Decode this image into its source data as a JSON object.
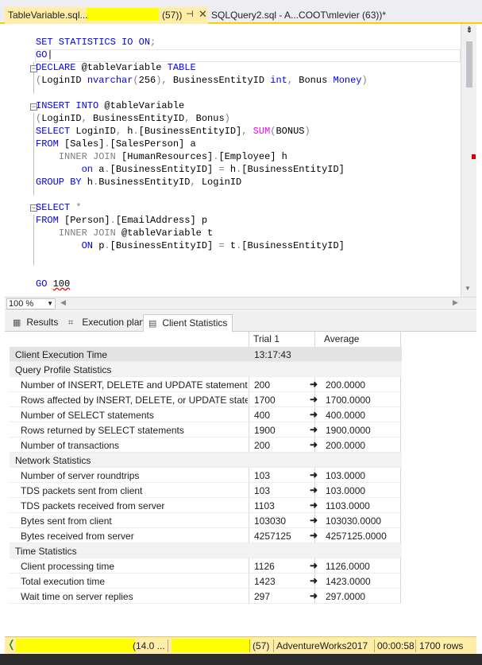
{
  "tabs": {
    "active": {
      "name": "TableVariable.sql...",
      "session": "(57))",
      "pin_icon": "pin-icon",
      "close_icon": "close-icon"
    },
    "inactive": {
      "label": "SQLQuery2.sql - A...COOT\\mlevier (63))*"
    }
  },
  "editor": {
    "lines": [
      [
        [
          "kw",
          "SET STATISTICS IO ON"
        ],
        [
          "gr",
          ";"
        ]
      ],
      [
        [
          "kw",
          "GO"
        ],
        [
          "",
          "|"
        ]
      ],
      [
        [
          "kw",
          "DECLARE"
        ],
        [
          "",
          " @tableVariable "
        ],
        [
          "kw",
          "TABLE"
        ]
      ],
      [
        [
          "gr",
          "("
        ],
        [
          "",
          "LoginID "
        ],
        [
          "kw",
          "nvarchar"
        ],
        [
          "gr",
          "("
        ],
        [
          "",
          "256"
        ],
        [
          "gr",
          "),"
        ],
        [
          "",
          " BusinessEntityID "
        ],
        [
          "kw",
          "int"
        ],
        [
          "gr",
          ","
        ],
        [
          "",
          " Bonus "
        ],
        [
          "kw",
          "Money"
        ],
        [
          "gr",
          ")"
        ]
      ],
      [
        [
          "",
          ""
        ]
      ],
      [
        [
          "kw",
          "INSERT INTO"
        ],
        [
          "",
          " @tableVariable"
        ]
      ],
      [
        [
          "gr",
          "("
        ],
        [
          "",
          "LoginID"
        ],
        [
          "gr",
          ","
        ],
        [
          "",
          " BusinessEntityID"
        ],
        [
          "gr",
          ","
        ],
        [
          "",
          " Bonus"
        ],
        [
          "gr",
          ")"
        ]
      ],
      [
        [
          "kw",
          "SELECT"
        ],
        [
          "",
          " LoginID"
        ],
        [
          "gr",
          ","
        ],
        [
          "",
          " h"
        ],
        [
          "gr",
          "."
        ],
        [
          "",
          "[BusinessEntityID]"
        ],
        [
          "gr",
          ","
        ],
        [
          "",
          " "
        ],
        [
          "fn",
          "SUM"
        ],
        [
          "gr",
          "("
        ],
        [
          "",
          "BONUS"
        ],
        [
          "gr",
          ")"
        ]
      ],
      [
        [
          "kw",
          "FROM"
        ],
        [
          "",
          " [Sales]"
        ],
        [
          "gr",
          "."
        ],
        [
          "",
          "[SalesPerson] a"
        ]
      ],
      [
        [
          "",
          "    "
        ],
        [
          "gr",
          "INNER JOIN"
        ],
        [
          "",
          " [HumanResources]"
        ],
        [
          "gr",
          "."
        ],
        [
          "",
          "[Employee] h"
        ]
      ],
      [
        [
          "",
          "        "
        ],
        [
          "kw",
          "on"
        ],
        [
          "",
          " a"
        ],
        [
          "gr",
          "."
        ],
        [
          "",
          "[BusinessEntityID] "
        ],
        [
          "gr",
          "="
        ],
        [
          "",
          " h"
        ],
        [
          "gr",
          "."
        ],
        [
          "",
          "[BusinessEntityID]"
        ]
      ],
      [
        [
          "kw",
          "GROUP BY"
        ],
        [
          "",
          " h"
        ],
        [
          "gr",
          "."
        ],
        [
          "",
          "BusinessEntityID"
        ],
        [
          "gr",
          ","
        ],
        [
          "",
          " LoginID"
        ]
      ],
      [
        [
          "",
          ""
        ]
      ],
      [
        [
          "",
          "",
          " "
        ],
        [
          "kw",
          "SELECT"
        ],
        [
          "",
          " "
        ],
        [
          "gr",
          "*"
        ]
      ],
      [
        [
          "",
          "",
          " "
        ],
        [
          "kw",
          "FROM"
        ],
        [
          "",
          " [Person]"
        ],
        [
          "gr",
          "."
        ],
        [
          "",
          "[EmailAddress] p"
        ]
      ],
      [
        [
          "",
          "    "
        ],
        [
          "gr",
          "INNER JOIN"
        ],
        [
          "",
          " @tableVariable t"
        ]
      ],
      [
        [
          "",
          "        "
        ],
        [
          "kw",
          "ON"
        ],
        [
          "",
          " p"
        ],
        [
          "gr",
          "."
        ],
        [
          "",
          "[BusinessEntityID] "
        ],
        [
          "gr",
          "="
        ],
        [
          "",
          " t"
        ],
        [
          "gr",
          "."
        ],
        [
          "",
          "[BusinessEntityID]"
        ]
      ],
      [
        [
          "",
          ""
        ]
      ],
      [
        [
          "",
          ""
        ]
      ],
      [
        [
          "kw",
          "GO"
        ],
        [
          "",
          " "
        ],
        [
          "sq",
          "100"
        ]
      ]
    ]
  },
  "zoom": {
    "value": "100 %"
  },
  "results_tabs": [
    {
      "label": "Results",
      "icon": "grid-icon"
    },
    {
      "label": "Execution plan",
      "icon": "execution-plan-icon"
    },
    {
      "label": "Client Statistics",
      "icon": "statistics-icon"
    }
  ],
  "stats": {
    "headers": {
      "trial": "Trial 1",
      "average": "Average"
    },
    "rows": [
      {
        "type": "first",
        "label": "Client Execution Time",
        "trial": "13:17:43",
        "avg": ""
      },
      {
        "type": "section",
        "label": "Query Profile Statistics"
      },
      {
        "type": "data",
        "label": "Number of INSERT, DELETE and UPDATE statements",
        "trial": "200",
        "avg": "200.0000"
      },
      {
        "type": "data",
        "label": "Rows affected by INSERT, DELETE, or UPDATE statem...",
        "trial": "1700",
        "avg": "1700.0000"
      },
      {
        "type": "data",
        "label": "Number of SELECT statements",
        "trial": "400",
        "avg": "400.0000"
      },
      {
        "type": "data",
        "label": "Rows returned by SELECT statements",
        "trial": "1900",
        "avg": "1900.0000"
      },
      {
        "type": "data",
        "label": "Number of transactions",
        "trial": "200",
        "avg": "200.0000"
      },
      {
        "type": "section",
        "label": "Network Statistics"
      },
      {
        "type": "data",
        "label": "Number of server roundtrips",
        "trial": "103",
        "avg": "103.0000"
      },
      {
        "type": "data",
        "label": "TDS packets sent from client",
        "trial": "103",
        "avg": "103.0000"
      },
      {
        "type": "data",
        "label": "TDS packets received from server",
        "trial": "1103",
        "avg": "1103.0000"
      },
      {
        "type": "data",
        "label": "Bytes sent from client",
        "trial": "103030",
        "avg": "103030.0000"
      },
      {
        "type": "data",
        "label": "Bytes received from server",
        "trial": "4257125",
        "avg": "4257125.0000"
      },
      {
        "type": "section",
        "label": "Time Statistics"
      },
      {
        "type": "data",
        "label": "Client processing time",
        "trial": "1126",
        "avg": "1126.0000"
      },
      {
        "type": "data",
        "label": "Total execution time",
        "trial": "1423",
        "avg": "1423.0000"
      },
      {
        "type": "data",
        "label": "Wait time on server replies",
        "trial": "297",
        "avg": "297.0000"
      }
    ],
    "arrow": "➜"
  },
  "statusbar": {
    "check_icon": "check-icon",
    "version": "(14.0 ...",
    "session": "(57)",
    "database": "AdventureWorks2017",
    "elapsed": "00:00:58",
    "rows": "1700 rows"
  }
}
